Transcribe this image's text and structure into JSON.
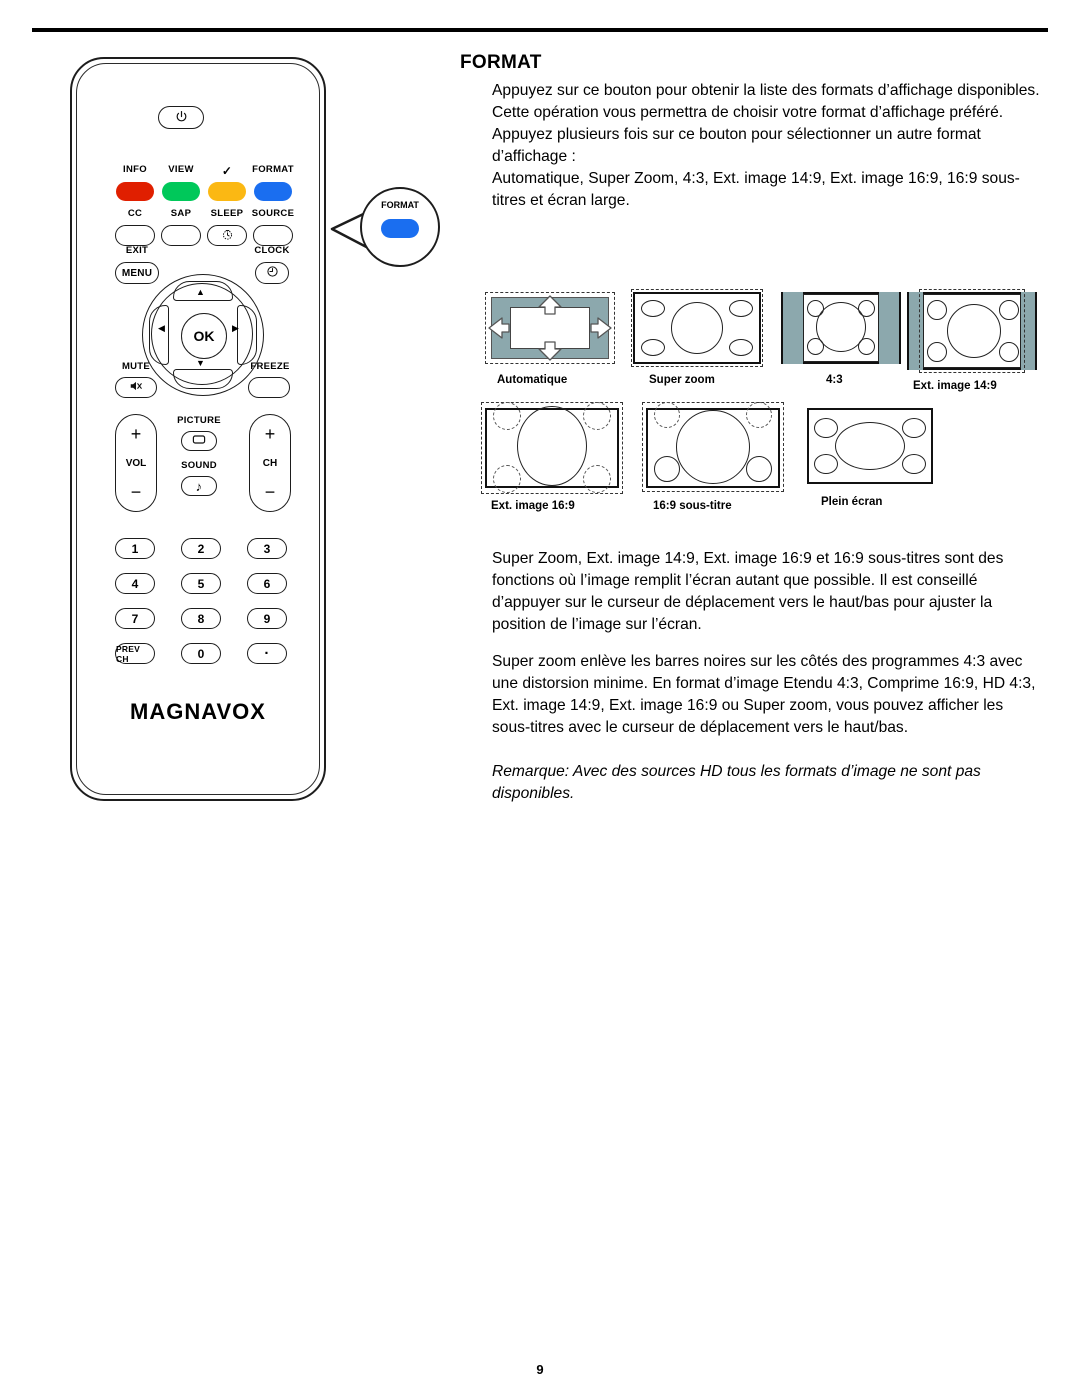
{
  "document": {
    "page_number": "9",
    "section_title": "FORMAT"
  },
  "paragraphs": {
    "p1": "Appuyez sur ce bouton pour obtenir la liste des formats d’affichage disponibles.",
    "p2": "Cette opération vous permettra de choisir votre format d’affichage préféré.",
    "p3": "Appuyez plusieurs fois sur ce bouton pour sélectionner un autre format d’affichage :",
    "p4": "Automatique, Super Zoom, 4:3, Ext. image 14:9, Ext. image 16:9, 16:9 sous-titres et écran large.",
    "p5": "Super Zoom, Ext. image 14:9, Ext. image 16:9 et 16:9 sous-titres sont des fonctions où l’image remplit l’écran autant que possible. Il est conseillé d’appuyer sur le curseur de déplacement vers le haut/bas pour ajuster la position de l’image sur l’écran.",
    "p6": "Super zoom enlève les barres noires sur les côtés des programmes 4:3 avec une distorsion minime. En format d’image Etendu 4:3, Comprime 16:9, HD 4:3, Ext. image 14:9, Ext. image 16:9 ou Super zoom, vous pouvez afficher les sous-titres avec le curseur de déplacement vers le haut/bas.",
    "note": "Remarque: Avec des sources HD tous les formats d’image ne sont pas disponibles."
  },
  "format_thumbnails": {
    "row1": [
      {
        "label": "Automatique"
      },
      {
        "label": "Super zoom"
      },
      {
        "label": "4:3"
      },
      {
        "label": "Ext. image 14:9"
      }
    ],
    "row2": [
      {
        "label": "Ext. image 16:9"
      },
      {
        "label": "16:9 sous-titre"
      },
      {
        "label": "Plein écran"
      }
    ]
  },
  "remote": {
    "brand": "MAGNAVOX",
    "power_icon": "power-icon",
    "color_buttons": [
      {
        "label": "INFO",
        "color": "#e01f00"
      },
      {
        "label": "VIEW",
        "color": "#00c85a"
      },
      {
        "label": "✓",
        "color": "#fbb813"
      },
      {
        "label": "FORMAT",
        "color": "#1a6ef0"
      }
    ],
    "function_row": [
      {
        "label": "CC",
        "glyph": ""
      },
      {
        "label": "SAP",
        "glyph": ""
      },
      {
        "label": "SLEEP",
        "glyph": "sleep-timer-icon"
      },
      {
        "label": "SOURCE",
        "glyph": ""
      }
    ],
    "menu": {
      "top_label": "EXIT",
      "label": "MENU"
    },
    "clock": {
      "top_label": "CLOCK",
      "glyph": "clock-icon"
    },
    "nav": {
      "ok_label": "OK",
      "up": "▲",
      "down": "▼",
      "left": "◀",
      "right": "▶"
    },
    "mute": {
      "label": "MUTE",
      "glyph": "mute-icon"
    },
    "freeze": {
      "label": "FREEZE"
    },
    "volume": {
      "name": "VOL",
      "plus": "+",
      "minus": "−"
    },
    "channel": {
      "name": "CH",
      "plus": "+",
      "minus": "−"
    },
    "picture": {
      "label": "PICTURE",
      "glyph": "picture-icon"
    },
    "sound": {
      "label": "SOUND",
      "glyph": "♪"
    },
    "keypad": [
      [
        "1",
        "2",
        "3"
      ],
      [
        "4",
        "5",
        "6"
      ],
      [
        "7",
        "8",
        "9"
      ],
      [
        "PREV CH",
        "0",
        "·"
      ]
    ],
    "callout": {
      "label": "FORMAT",
      "color": "#1a6ef0"
    }
  }
}
